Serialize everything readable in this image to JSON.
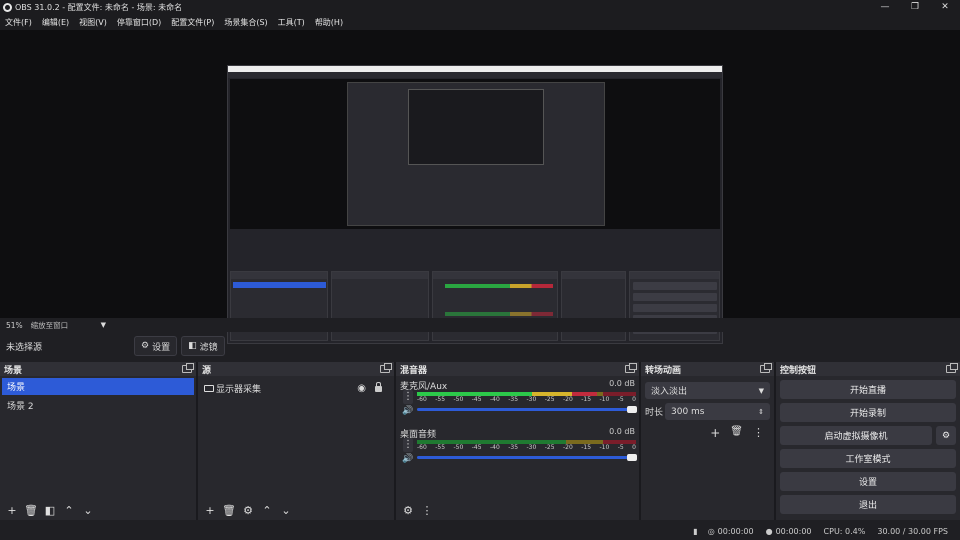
{
  "window": {
    "title": "OBS 31.0.2 - 配置文件: 未命名 - 场景: 未命名",
    "min": "—",
    "max": "❐",
    "close": "✕"
  },
  "menu": [
    "文件(F)",
    "编辑(E)",
    "视图(V)",
    "停靠窗口(D)",
    "配置文件(P)",
    "场景集合(S)",
    "工具(T)",
    "帮助(H)"
  ],
  "preview": {
    "zoom": "51%",
    "zoom_mode": "缩放至窗口"
  },
  "toolbar": {
    "no_source": "未选择源",
    "settings": "设置",
    "filters": "滤镜"
  },
  "scenes": {
    "title": "场景",
    "items": [
      "场景",
      "场景 2"
    ],
    "active": 0
  },
  "sources": {
    "title": "源",
    "items": [
      {
        "label": "显示器采集"
      }
    ]
  },
  "mixer": {
    "title": "混音器",
    "scale": [
      "-60",
      "-55",
      "-50",
      "-45",
      "-40",
      "-35",
      "-30",
      "-25",
      "-20",
      "-15",
      "-10",
      "-5",
      "0"
    ],
    "channels": [
      {
        "name": "麦克风/Aux",
        "db": "0.0 dB",
        "level": 0.82
      },
      {
        "name": "桌面音频",
        "db": "0.0 dB",
        "level": 0.0
      }
    ]
  },
  "transitions": {
    "title": "转场动画",
    "type": "淡入淡出",
    "duration_label": "时长",
    "duration": "300 ms"
  },
  "controls": {
    "title": "控制按钮",
    "buttons": [
      "开始直播",
      "开始录制",
      "启动虚拟摄像机",
      "工作室模式",
      "设置",
      "退出"
    ]
  },
  "statusbar": {
    "stream_time": "00:00:00",
    "rec_time": "00:00:00",
    "cpu": "CPU: 0.4%",
    "fps": "30.00 / 30.00 FPS"
  }
}
